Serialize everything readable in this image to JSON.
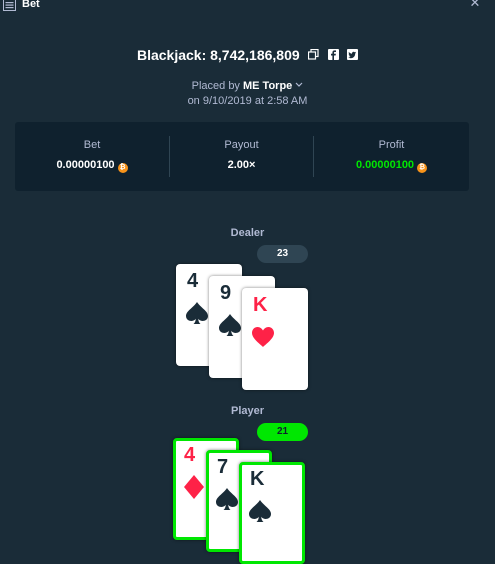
{
  "header": {
    "title": "Bet"
  },
  "bet": {
    "game": "Blackjack",
    "id": "8,742,186,809",
    "title_full": "Blackjack: 8,742,186,809",
    "placed_by_prefix": "Placed by",
    "user": "ME Torpe",
    "when": "on 9/10/2019 at 2:58 AM"
  },
  "stats": {
    "bet": {
      "label": "Bet",
      "value": "0.00000100"
    },
    "payout": {
      "label": "Payout",
      "value": "2.00×"
    },
    "profit": {
      "label": "Profit",
      "value": "0.00000100"
    }
  },
  "dealer": {
    "label": "Dealer",
    "score": "23",
    "cards": [
      {
        "rank": "4",
        "suit": "spade",
        "color": "black"
      },
      {
        "rank": "9",
        "suit": "spade",
        "color": "black"
      },
      {
        "rank": "K",
        "suit": "heart",
        "color": "red"
      }
    ]
  },
  "player": {
    "label": "Player",
    "score": "21",
    "cards": [
      {
        "rank": "4",
        "suit": "diamond",
        "color": "red"
      },
      {
        "rank": "7",
        "suit": "spade",
        "color": "black"
      },
      {
        "rank": "K",
        "suit": "spade",
        "color": "black"
      }
    ]
  },
  "colors": {
    "background": "#1a2c38",
    "panel": "#0f212e",
    "win": "#00e701",
    "red_suit": "#fe2247",
    "coin": "#f7931a"
  },
  "icons": [
    "bet-list-icon",
    "close-icon",
    "copy-icon",
    "facebook-icon",
    "twitter-icon",
    "chevron-down-icon",
    "bitcoin-icon",
    "spade-icon",
    "heart-icon",
    "diamond-icon"
  ]
}
